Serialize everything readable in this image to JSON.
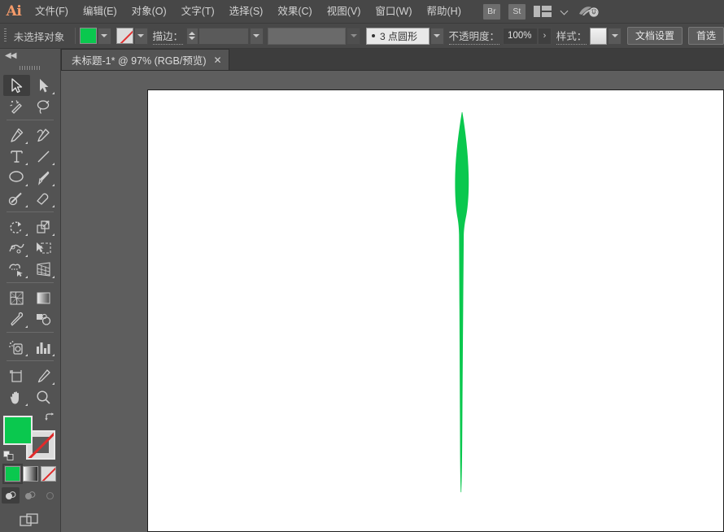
{
  "app": {
    "name": "Ai",
    "logo_text": "Ai"
  },
  "menubar": {
    "items": [
      {
        "label": "文件(F)",
        "name": "menu-file"
      },
      {
        "label": "编辑(E)",
        "name": "menu-edit"
      },
      {
        "label": "对象(O)",
        "name": "menu-object"
      },
      {
        "label": "文字(T)",
        "name": "menu-type"
      },
      {
        "label": "选择(S)",
        "name": "menu-select"
      },
      {
        "label": "效果(C)",
        "name": "menu-effect"
      },
      {
        "label": "视图(V)",
        "name": "menu-view"
      },
      {
        "label": "窗口(W)",
        "name": "menu-window"
      },
      {
        "label": "帮助(H)",
        "name": "menu-help"
      }
    ],
    "bridge_badge": "Br",
    "stock_badge": "St",
    "arrange_icon": "arrange-documents-icon",
    "arrange_caret": "chevron-down-icon",
    "cc_icon": "creative-cloud-sync-icon"
  },
  "optionbar": {
    "selection_label": "未选择对象",
    "fill_swatch_color": "#0ac84e",
    "fill_swatch_name": "fill-color-swatch",
    "stroke_swatch_name": "stroke-color-swatch",
    "stroke_label": "描边：",
    "stroke_weight_value": "",
    "stroke_profile_value": "",
    "brush_definition": "3 点圆形",
    "brush_bullet": "•",
    "opacity_label": "不透明度：",
    "opacity_value": "100%",
    "opacity_arrow": "›",
    "style_label": "样式：",
    "document_setup_label": "文档设置",
    "preferences_label": "首选"
  },
  "tabbar": {
    "tab_title": "未标题-1* @ 97% (RGB/预览)",
    "tab_close": "✕"
  },
  "toolpanel": {
    "collapse_label": "◀◀",
    "groups": [
      {
        "tools": [
          {
            "name": "selection-tool",
            "icon": "selection-arrow-icon",
            "active": true,
            "corner": false
          },
          {
            "name": "direct-selection-tool",
            "icon": "direct-selection-arrow-icon",
            "active": false,
            "corner": true
          },
          {
            "name": "magic-wand-tool",
            "icon": "magic-wand-icon",
            "active": false,
            "corner": false
          },
          {
            "name": "lasso-tool",
            "icon": "lasso-icon",
            "active": false,
            "corner": false
          }
        ]
      },
      {
        "tools": [
          {
            "name": "pen-tool",
            "icon": "pen-icon",
            "active": false,
            "corner": true
          },
          {
            "name": "curvature-tool",
            "icon": "curvature-icon",
            "active": false,
            "corner": false
          },
          {
            "name": "type-tool",
            "icon": "type-t-icon",
            "active": false,
            "corner": true
          },
          {
            "name": "line-segment-tool",
            "icon": "line-segment-icon",
            "active": false,
            "corner": true
          },
          {
            "name": "ellipse-tool",
            "icon": "ellipse-icon",
            "active": false,
            "corner": true
          },
          {
            "name": "paintbrush-tool",
            "icon": "paintbrush-icon",
            "active": false,
            "corner": true
          },
          {
            "name": "shaper-tool",
            "icon": "shaper-pencil-icon",
            "active": false,
            "corner": true
          },
          {
            "name": "eraser-tool",
            "icon": "eraser-icon",
            "active": false,
            "corner": true
          }
        ]
      },
      {
        "tools": [
          {
            "name": "rotate-tool",
            "icon": "rotate-icon",
            "active": false,
            "corner": true
          },
          {
            "name": "scale-tool",
            "icon": "scale-icon",
            "active": false,
            "corner": true
          },
          {
            "name": "width-tool",
            "icon": "width-icon",
            "active": false,
            "corner": true
          },
          {
            "name": "free-transform-tool",
            "icon": "free-transform-icon",
            "active": false,
            "corner": false
          },
          {
            "name": "shape-builder-tool",
            "icon": "shape-builder-icon",
            "active": false,
            "corner": true
          },
          {
            "name": "perspective-grid-tool",
            "icon": "perspective-grid-icon",
            "active": false,
            "corner": true
          }
        ]
      },
      {
        "tools": [
          {
            "name": "mesh-tool",
            "icon": "mesh-icon",
            "active": false,
            "corner": false
          },
          {
            "name": "gradient-tool",
            "icon": "gradient-icon",
            "active": false,
            "corner": false
          },
          {
            "name": "eyedropper-tool",
            "icon": "eyedropper-icon",
            "active": false,
            "corner": true
          },
          {
            "name": "blend-tool",
            "icon": "blend-icon",
            "active": false,
            "corner": false
          }
        ]
      },
      {
        "tools": [
          {
            "name": "symbol-sprayer-tool",
            "icon": "symbol-sprayer-icon",
            "active": false,
            "corner": true
          },
          {
            "name": "column-graph-tool",
            "icon": "column-graph-icon",
            "active": false,
            "corner": true
          }
        ]
      },
      {
        "tools": [
          {
            "name": "artboard-tool",
            "icon": "artboard-icon",
            "active": false,
            "corner": false
          },
          {
            "name": "slice-tool",
            "icon": "slice-knife-icon",
            "active": false,
            "corner": true
          },
          {
            "name": "hand-tool",
            "icon": "hand-icon",
            "active": false,
            "corner": true
          },
          {
            "name": "zoom-tool",
            "icon": "magnifier-icon",
            "active": false,
            "corner": false
          }
        ]
      }
    ],
    "fill_color": "#0ac84e",
    "fill_name": "fill-color-box",
    "stroke_name": "stroke-color-box",
    "swap_icon": "swap-fill-stroke-icon",
    "default_icon": "default-fill-stroke-icon",
    "color_modes": [
      {
        "name": "color-mode-solid",
        "selected": true
      },
      {
        "name": "color-mode-gradient",
        "selected": false
      },
      {
        "name": "color-mode-none",
        "selected": false
      }
    ],
    "draw_modes": [
      {
        "name": "draw-normal-mode",
        "active": true
      },
      {
        "name": "draw-behind-mode",
        "active": false
      },
      {
        "name": "draw-inside-mode",
        "active": false
      }
    ],
    "screen_mode": {
      "name": "change-screen-mode-button"
    }
  },
  "canvas": {
    "artwork_name": "leaf-blade-artwork",
    "artwork_color": "#0ac84e",
    "background_color": "#5e5e5e",
    "artboard_color": "#ffffff",
    "zoom_level": "97%"
  }
}
